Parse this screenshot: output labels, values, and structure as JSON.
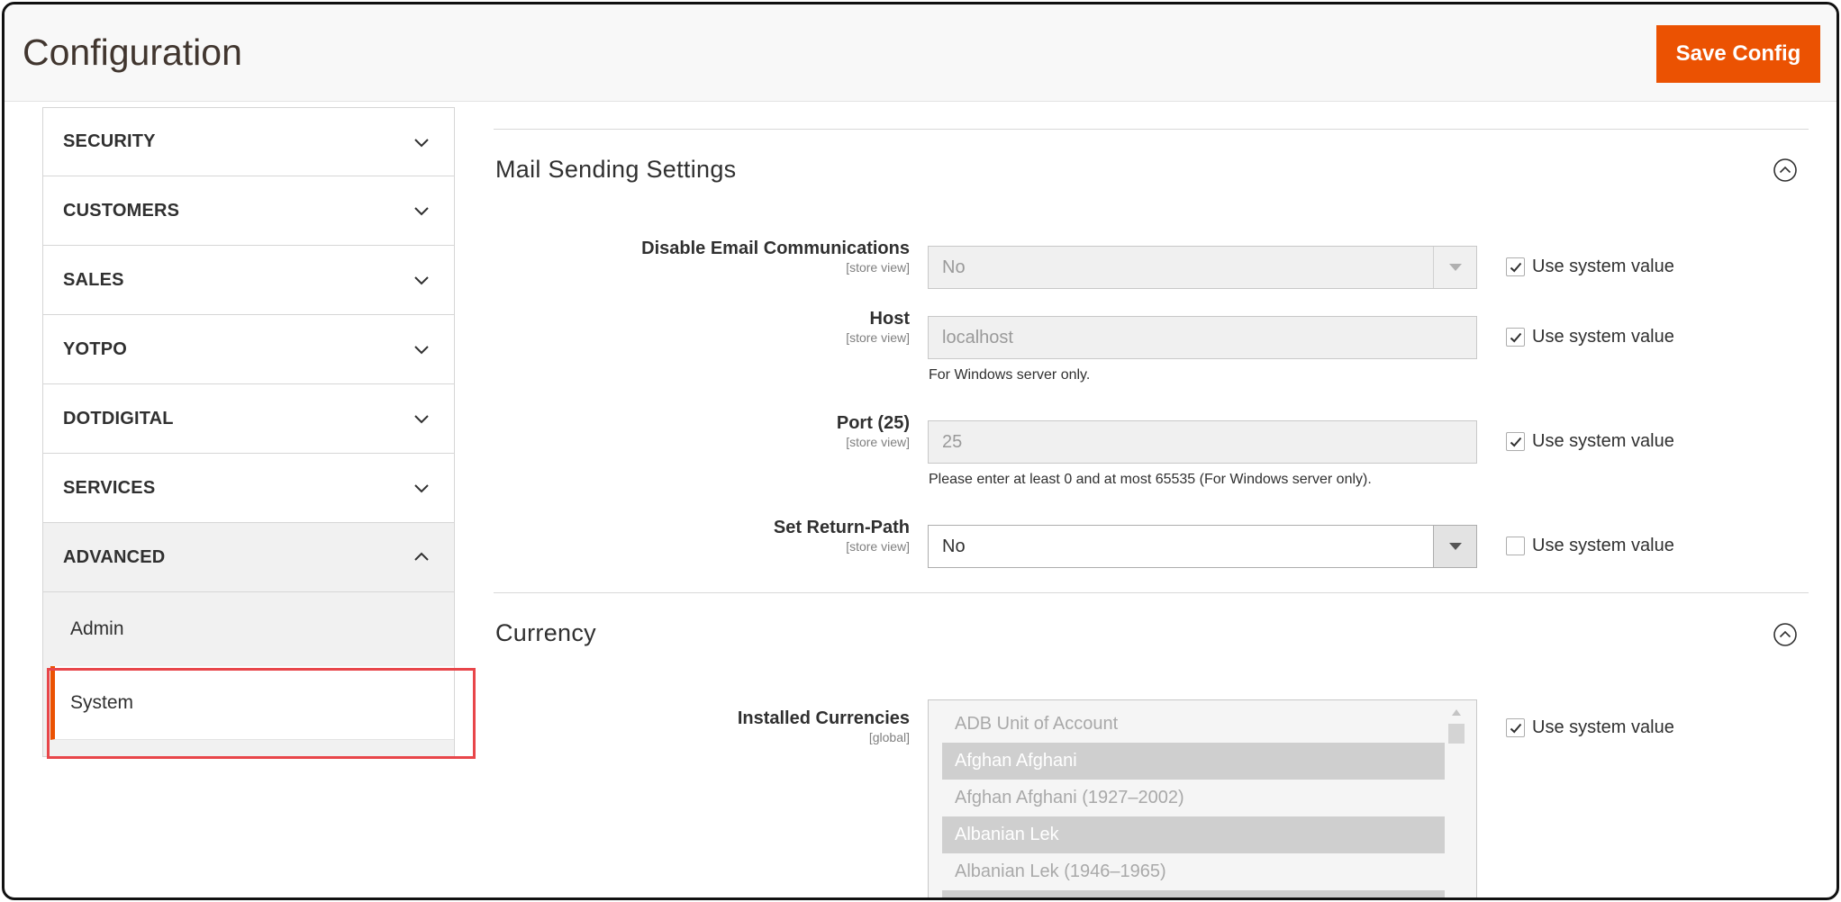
{
  "header": {
    "title": "Configuration",
    "save_label": "Save Config"
  },
  "sidebar": {
    "items": [
      {
        "label": "SECURITY"
      },
      {
        "label": "CUSTOMERS"
      },
      {
        "label": "SALES"
      },
      {
        "label": "YOTPO"
      },
      {
        "label": "DOTDIGITAL"
      },
      {
        "label": "SERVICES"
      },
      {
        "label": "ADVANCED"
      }
    ],
    "advanced_children": [
      {
        "label": "Admin"
      },
      {
        "label": "System"
      }
    ]
  },
  "mail": {
    "title": "Mail Sending Settings",
    "fields": [
      {
        "label": "Disable Email Communications",
        "scope": "[store view]",
        "value": "No",
        "note": "",
        "use_system": "Use system value"
      },
      {
        "label": "Host",
        "scope": "[store view]",
        "value": "localhost",
        "note": "For Windows server only.",
        "use_system": "Use system value"
      },
      {
        "label": "Port (25)",
        "scope": "[store view]",
        "value": "25",
        "note": "Please enter at least 0 and at most 65535 (For Windows server only).",
        "use_system": "Use system value"
      },
      {
        "label": "Set Return-Path",
        "scope": "[store view]",
        "value": "No",
        "note": "",
        "use_system": "Use system value"
      }
    ]
  },
  "currency": {
    "title": "Currency",
    "installed_label": "Installed Currencies",
    "installed_scope": "[global]",
    "use_system": "Use system value",
    "options": [
      "ADB Unit of Account",
      "Afghan Afghani",
      "Afghan Afghani (1927–2002)",
      "Albanian Lek",
      "Albanian Lek (1946–1965)"
    ]
  },
  "colors": {
    "accent": "#eb5202",
    "highlight": "#e8464a"
  }
}
